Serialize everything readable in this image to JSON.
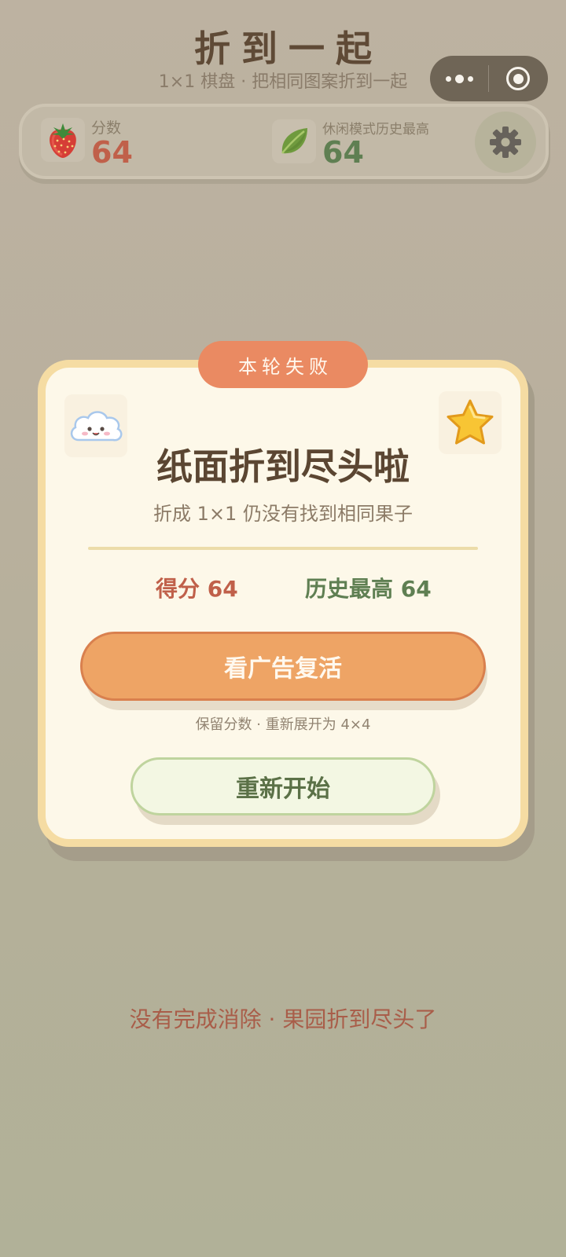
{
  "header": {
    "title": "折到一起",
    "subtitle": "1×1 棋盘 · 把相同图案折到一起"
  },
  "capsule": {
    "more_icon": "more-dots-icon",
    "close_icon": "target-close-icon"
  },
  "scorebar": {
    "score_label": "分数",
    "score_value": "64",
    "score_icon": "strawberry-icon",
    "best_label": "休闲模式历史最高",
    "best_value": "64",
    "best_icon": "leaf-icon",
    "settings_icon": "gear-icon"
  },
  "dialog": {
    "badge": "本轮失败",
    "left_sticker": "cloud-icon",
    "right_sticker": "star-icon",
    "title": "纸面折到尽头啦",
    "subtitle": "折成 1×1 仍没有找到相同果子",
    "score_text": "得分  64",
    "best_text": "历史最高  64",
    "revive_button": "看广告复活",
    "revive_note": "保留分数 · 重新展开为 4×4",
    "restart_button": "重新开始"
  },
  "footer": {
    "message": "没有完成消除 · 果园折到尽头了"
  },
  "colors": {
    "score_red": "#c0604a",
    "best_green": "#5f7f52",
    "revive_orange": "#eea465",
    "badge_orange": "#ea8a62",
    "footer_red": "#a95d49"
  }
}
